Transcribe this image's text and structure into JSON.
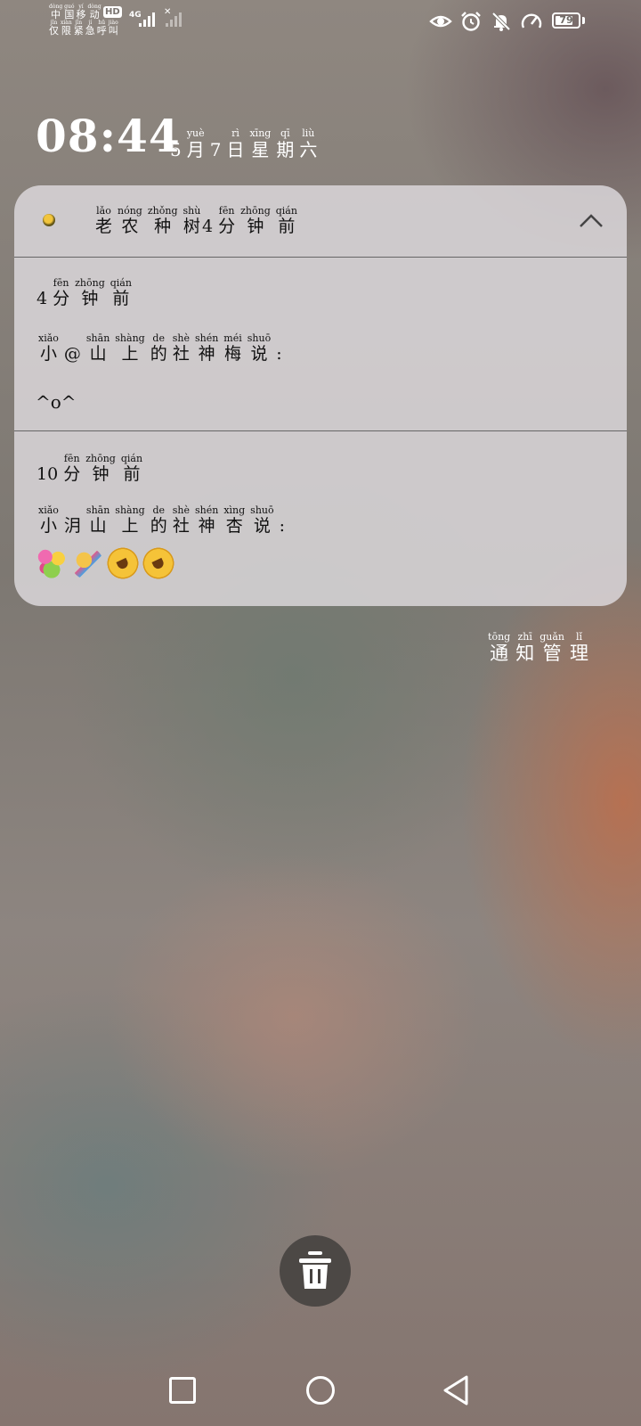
{
  "status_bar": {
    "carrier_1": [
      [
        "dòng",
        "中"
      ],
      [
        "guó",
        "国"
      ],
      [
        "yí",
        "移"
      ],
      [
        "dòng",
        "动"
      ]
    ],
    "carrier_2": [
      [
        "jǐn",
        "仅"
      ],
      [
        "xiàn",
        "限"
      ],
      [
        "jǐn",
        "紧"
      ],
      [
        "jí",
        "急"
      ],
      [
        "hū",
        "呼"
      ],
      [
        "jiào",
        "叫"
      ]
    ],
    "hd": "HD",
    "network": "4G",
    "battery_level": 79,
    "battery_text": "79"
  },
  "lockscreen": {
    "time": "08:44",
    "date": [
      [
        "",
        "5"
      ],
      [
        "yuè",
        "月"
      ],
      [
        "",
        "7"
      ],
      [
        "rì",
        "日"
      ],
      [
        "xīng",
        "星"
      ],
      [
        "qī",
        "期"
      ],
      [
        "liù",
        "六"
      ]
    ]
  },
  "notification": {
    "app_name": [
      [
        "lǎo",
        "老"
      ],
      [
        "nóng",
        "农"
      ],
      [
        "zhǒng",
        "种"
      ],
      [
        "shù",
        "树"
      ]
    ],
    "header_time": [
      [
        "",
        "4"
      ],
      [
        "fēn",
        "分"
      ],
      [
        "zhōng",
        "钟"
      ],
      [
        "qián",
        "前"
      ]
    ],
    "messages": [
      {
        "time": [
          [
            "",
            "4"
          ],
          [
            "fēn",
            "分"
          ],
          [
            "zhōng",
            "钟"
          ],
          [
            "qián",
            "前"
          ]
        ],
        "sender": [
          [
            "xiǎo",
            "小"
          ],
          [
            "",
            "@"
          ],
          [
            "shān",
            "山"
          ],
          [
            "shàng",
            "上"
          ],
          [
            "de",
            "的"
          ],
          [
            "shè",
            "社"
          ],
          [
            "shén",
            "神"
          ],
          [
            "méi",
            "梅"
          ],
          [
            "shuō",
            "说"
          ],
          [
            "",
            ":"
          ]
        ],
        "body": "^o^"
      },
      {
        "time": [
          [
            "",
            "10"
          ],
          [
            "fēn",
            "分"
          ],
          [
            "zhōng",
            "钟"
          ],
          [
            "qián",
            "前"
          ]
        ],
        "sender": [
          [
            "xiǎo",
            "小"
          ],
          [
            "",
            "㳉"
          ],
          [
            "shān",
            "山"
          ],
          [
            "shàng",
            "上"
          ],
          [
            "de",
            "的"
          ],
          [
            "shè",
            "社"
          ],
          [
            "shén",
            "神"
          ],
          [
            "xìng",
            "杏"
          ],
          [
            "shuō",
            "说"
          ],
          [
            "",
            ":"
          ]
        ],
        "emojis": [
          "bouquet-emoji",
          "party-popper-emoji",
          "rolling-laughing-emoji",
          "rolling-laughing-emoji"
        ]
      }
    ]
  },
  "notification_management": [
    [
      "tōng",
      "通"
    ],
    [
      "zhī",
      "知"
    ],
    [
      "guǎn",
      "管"
    ],
    [
      "lǐ",
      "理"
    ]
  ],
  "colors": {
    "card_bg": "#dedade",
    "text_white": "#ffffff",
    "trash_bg": "#464240"
  }
}
